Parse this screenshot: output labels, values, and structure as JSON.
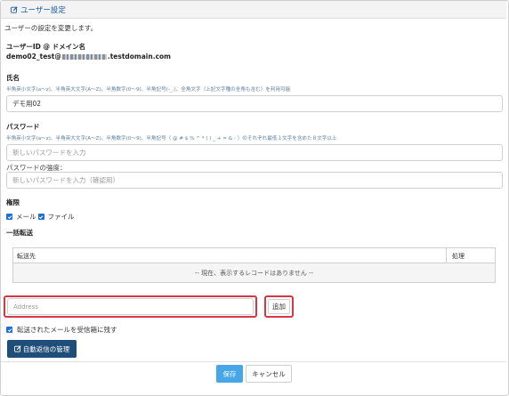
{
  "header": {
    "title": "ユーザー設定",
    "icon": "edit-icon"
  },
  "description": "ユーザーの設定を変更します。",
  "user_id": {
    "label": "ユーザーID @ ドメイン名",
    "prefix": "demo02_test@",
    "suffix": ".testdomain.com"
  },
  "name": {
    "label": "氏名",
    "hint": "半角英小文字(a〜z)、半角英大文字(A〜Z)、半角数字(0〜9)、半角記号(-_.)、全角文字（上記文字種の全角も含む）を利用可能",
    "value": "デモ用02"
  },
  "password": {
    "label": "パスワード",
    "hint": "半角英小文字(a〜z)、半角英大文字(A〜Z)、半角数字(0〜9)、半角記号（ @ # $ % ^ * ( ) _ + = & - ）のそれぞれ最低１文字を含めた８文字以上",
    "placeholder": "新しいパスワードを入力",
    "strength_label": "パスワードの強度：",
    "confirm_placeholder": "新しいパスワードを入力（確認用）"
  },
  "permissions": {
    "label": "権限",
    "mail_label": "メール",
    "file_label": "ファイル",
    "mail_checked": true,
    "file_checked": true
  },
  "forwarding": {
    "label": "一括転送",
    "col_destination": "転送先",
    "col_action": "処理",
    "empty_message": "-- 現在、表示するレコードはありません --",
    "address_placeholder": "Address",
    "add_label": "追加",
    "keep_label": "転送されたメールを受信箱に残す",
    "keep_checked": true
  },
  "auto_reply_label": "自動返信の管理",
  "save_label": "保存",
  "cancel_label": "キャンセル",
  "colors": {
    "accent": "#1e6fd9",
    "header_text": "#1a5aa0",
    "highlight": "#d63744",
    "dark_button": "#1f4e78",
    "save_button": "#47a6e8"
  }
}
